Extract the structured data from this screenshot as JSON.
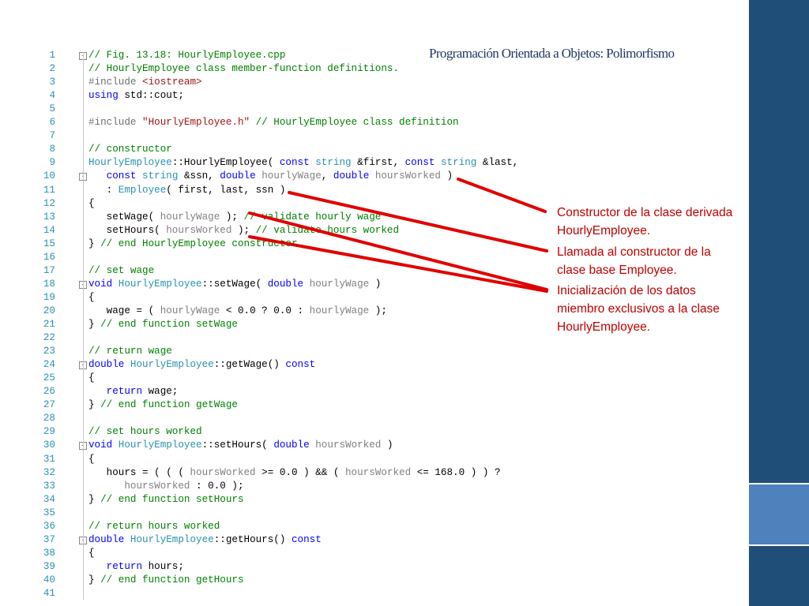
{
  "title": "Programación Orientada a Objetos: Polimorfismo",
  "colors": {
    "dark_bar": "#1f4e79",
    "light_bar": "#4f81bd",
    "annotation": "#c00000",
    "comment": "#008000",
    "keyword": "#0000ff",
    "type": "#2b91af"
  },
  "code_lines": [
    {
      "n": "1",
      "fold": "-",
      "tokens": [
        {
          "t": "// Fig. 13.18: HourlyEmployee.cpp",
          "c": "comment"
        }
      ]
    },
    {
      "n": "2",
      "tokens": [
        {
          "t": "// HourlyEmployee class member-function definitions.",
          "c": "comment"
        }
      ]
    },
    {
      "n": "3",
      "tokens": [
        {
          "t": "#include ",
          "c": "pp"
        },
        {
          "t": "<iostream>",
          "c": "str"
        }
      ]
    },
    {
      "n": "4",
      "tokens": [
        {
          "t": "using ",
          "c": "kw"
        },
        {
          "t": "std::cout;",
          "c": "plain"
        }
      ]
    },
    {
      "n": "5",
      "tokens": []
    },
    {
      "n": "6",
      "tokens": [
        {
          "t": "#include ",
          "c": "pp"
        },
        {
          "t": "\"HourlyEmployee.h\"",
          "c": "str"
        },
        {
          "t": " // HourlyEmployee class definition",
          "c": "comment"
        }
      ]
    },
    {
      "n": "7",
      "tokens": []
    },
    {
      "n": "8",
      "tokens": [
        {
          "t": "// constructor",
          "c": "comment"
        }
      ]
    },
    {
      "n": "9",
      "tokens": [
        {
          "t": "HourlyEmployee",
          "c": "type"
        },
        {
          "t": "::HourlyEmployee( ",
          "c": "plain"
        },
        {
          "t": "const ",
          "c": "kw"
        },
        {
          "t": "string",
          "c": "type"
        },
        {
          "t": " &first, ",
          "c": "plain"
        },
        {
          "t": "const ",
          "c": "kw"
        },
        {
          "t": "string",
          "c": "type"
        },
        {
          "t": " &last,",
          "c": "plain"
        }
      ]
    },
    {
      "n": "10",
      "fold": "-",
      "tokens": [
        {
          "t": "   const ",
          "c": "kw"
        },
        {
          "t": "string",
          "c": "type"
        },
        {
          "t": " &ssn, ",
          "c": "plain"
        },
        {
          "t": "double ",
          "c": "kw"
        },
        {
          "t": "hourlyWage",
          "c": "param"
        },
        {
          "t": ", ",
          "c": "plain"
        },
        {
          "t": "double ",
          "c": "kw"
        },
        {
          "t": "hoursWorked",
          "c": "param"
        },
        {
          "t": " )",
          "c": "plain"
        }
      ]
    },
    {
      "n": "11",
      "tokens": [
        {
          "t": "   : ",
          "c": "plain"
        },
        {
          "t": "Employee",
          "c": "type"
        },
        {
          "t": "( first, last, ssn )",
          "c": "plain"
        }
      ]
    },
    {
      "n": "12",
      "tokens": [
        {
          "t": "{",
          "c": "plain"
        }
      ]
    },
    {
      "n": "13",
      "tokens": [
        {
          "t": "   setWage( ",
          "c": "plain"
        },
        {
          "t": "hourlyWage",
          "c": "param"
        },
        {
          "t": " ); ",
          "c": "plain"
        },
        {
          "t": "// validate hourly wage",
          "c": "comment"
        }
      ]
    },
    {
      "n": "14",
      "tokens": [
        {
          "t": "   setHours( ",
          "c": "plain"
        },
        {
          "t": "hoursWorked",
          "c": "param"
        },
        {
          "t": " ); ",
          "c": "plain"
        },
        {
          "t": "// validate hours worked",
          "c": "comment"
        }
      ]
    },
    {
      "n": "15",
      "tokens": [
        {
          "t": "} ",
          "c": "plain"
        },
        {
          "t": "// end HourlyEmployee constructor",
          "c": "comment"
        }
      ]
    },
    {
      "n": "16",
      "tokens": []
    },
    {
      "n": "17",
      "tokens": [
        {
          "t": "// set wage",
          "c": "comment"
        }
      ]
    },
    {
      "n": "18",
      "fold": "-",
      "tokens": [
        {
          "t": "void ",
          "c": "kw"
        },
        {
          "t": "HourlyEmployee",
          "c": "type"
        },
        {
          "t": "::setWage( ",
          "c": "plain"
        },
        {
          "t": "double ",
          "c": "kw"
        },
        {
          "t": "hourlyWage",
          "c": "param"
        },
        {
          "t": " )",
          "c": "plain"
        }
      ]
    },
    {
      "n": "19",
      "tokens": [
        {
          "t": "{",
          "c": "plain"
        }
      ]
    },
    {
      "n": "20",
      "tokens": [
        {
          "t": "   wage = ( ",
          "c": "plain"
        },
        {
          "t": "hourlyWage",
          "c": "param"
        },
        {
          "t": " < 0.0 ? 0.0 : ",
          "c": "plain"
        },
        {
          "t": "hourlyWage",
          "c": "param"
        },
        {
          "t": " );",
          "c": "plain"
        }
      ]
    },
    {
      "n": "21",
      "tokens": [
        {
          "t": "} ",
          "c": "plain"
        },
        {
          "t": "// end function setWage",
          "c": "comment"
        }
      ]
    },
    {
      "n": "22",
      "tokens": []
    },
    {
      "n": "23",
      "tokens": [
        {
          "t": "// return wage",
          "c": "comment"
        }
      ]
    },
    {
      "n": "24",
      "fold": "-",
      "tokens": [
        {
          "t": "double ",
          "c": "kw"
        },
        {
          "t": "HourlyEmployee",
          "c": "type"
        },
        {
          "t": "::getWage() ",
          "c": "plain"
        },
        {
          "t": "const",
          "c": "kw"
        }
      ]
    },
    {
      "n": "25",
      "tokens": [
        {
          "t": "{",
          "c": "plain"
        }
      ]
    },
    {
      "n": "26",
      "tokens": [
        {
          "t": "   return ",
          "c": "kw"
        },
        {
          "t": "wage;",
          "c": "plain"
        }
      ]
    },
    {
      "n": "27",
      "tokens": [
        {
          "t": "} ",
          "c": "plain"
        },
        {
          "t": "// end function getWage",
          "c": "comment"
        }
      ]
    },
    {
      "n": "28",
      "tokens": []
    },
    {
      "n": "29",
      "tokens": [
        {
          "t": "// set hours worked",
          "c": "comment"
        }
      ]
    },
    {
      "n": "30",
      "fold": "-",
      "tokens": [
        {
          "t": "void ",
          "c": "kw"
        },
        {
          "t": "HourlyEmployee",
          "c": "type"
        },
        {
          "t": "::setHours( ",
          "c": "plain"
        },
        {
          "t": "double ",
          "c": "kw"
        },
        {
          "t": "hoursWorked",
          "c": "param"
        },
        {
          "t": " )",
          "c": "plain"
        }
      ]
    },
    {
      "n": "31",
      "tokens": [
        {
          "t": "{",
          "c": "plain"
        }
      ]
    },
    {
      "n": "32",
      "tokens": [
        {
          "t": "   hours = ( ( ( ",
          "c": "plain"
        },
        {
          "t": "hoursWorked",
          "c": "param"
        },
        {
          "t": " >= 0.0 ) && ( ",
          "c": "plain"
        },
        {
          "t": "hoursWorked",
          "c": "param"
        },
        {
          "t": " <= 168.0 ) ) ?",
          "c": "plain"
        }
      ]
    },
    {
      "n": "33",
      "tokens": [
        {
          "t": "      ",
          "c": "plain"
        },
        {
          "t": "hoursWorked",
          "c": "param"
        },
        {
          "t": " : 0.0 );",
          "c": "plain"
        }
      ]
    },
    {
      "n": "34",
      "tokens": [
        {
          "t": "} ",
          "c": "plain"
        },
        {
          "t": "// end function setHours",
          "c": "comment"
        }
      ]
    },
    {
      "n": "35",
      "tokens": []
    },
    {
      "n": "36",
      "tokens": [
        {
          "t": "// return hours worked",
          "c": "comment"
        }
      ]
    },
    {
      "n": "37",
      "fold": "-",
      "tokens": [
        {
          "t": "double ",
          "c": "kw"
        },
        {
          "t": "HourlyEmployee",
          "c": "type"
        },
        {
          "t": "::getHours() ",
          "c": "plain"
        },
        {
          "t": "const",
          "c": "kw"
        }
      ]
    },
    {
      "n": "38",
      "tokens": [
        {
          "t": "{",
          "c": "plain"
        }
      ]
    },
    {
      "n": "39",
      "tokens": [
        {
          "t": "   return ",
          "c": "kw"
        },
        {
          "t": "hours;",
          "c": "plain"
        }
      ]
    },
    {
      "n": "40",
      "tokens": [
        {
          "t": "} ",
          "c": "plain"
        },
        {
          "t": "// end function getHours",
          "c": "comment"
        }
      ]
    },
    {
      "n": "41",
      "tokens": []
    }
  ],
  "annotations": [
    {
      "text": "Constructor de la clase derivada HourlyEmployee."
    },
    {
      "text": "Llamada al constructor de la clase base Employee."
    },
    {
      "text": "Inicialización de los datos miembro exclusivos a la clase HourlyEmployee."
    }
  ]
}
